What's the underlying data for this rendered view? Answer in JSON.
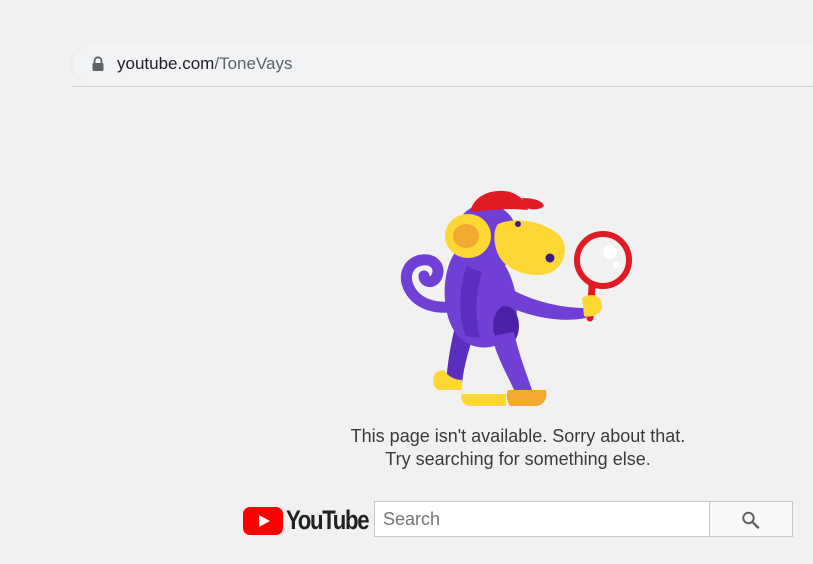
{
  "browser": {
    "url_host": "youtube.com",
    "url_path": "/ToneVays",
    "lock_icon": "lock-icon"
  },
  "illustration": {
    "icon": "monkey-with-magnifying-glass"
  },
  "message": {
    "line1": "This page isn't available. Sorry about that.",
    "line2": "Try searching for something else."
  },
  "logo": {
    "text": "YouTube",
    "icon": "youtube-play-icon"
  },
  "search": {
    "placeholder": "Search",
    "value": "",
    "button_icon": "search-icon"
  },
  "colors": {
    "background": "#f1f1f1",
    "brand_red": "#ff0000",
    "monkey_purple": "#6f3fd6",
    "monkey_yellow": "#fdd835"
  }
}
